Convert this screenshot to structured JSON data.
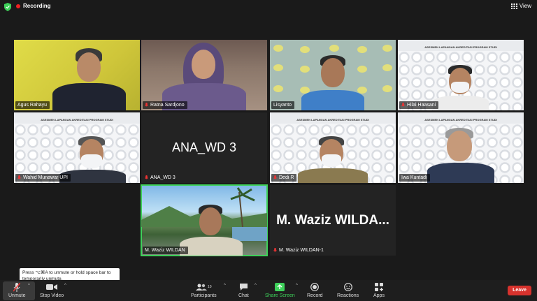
{
  "topbar": {
    "recording_label": "Recording",
    "view_label": "View"
  },
  "tiles": [
    {
      "name": "Agus Rahayu"
    },
    {
      "name": "Ratna Sardjono"
    },
    {
      "name": "Lisyanto"
    },
    {
      "name": "Hilal Haasani"
    },
    {
      "name": "Wahid Munawar UPI"
    },
    {
      "name": "ANA_WD 3",
      "big": "ANA_WD 3"
    },
    {
      "name": "Dedi R"
    },
    {
      "name": "Iwa Kuntadi"
    },
    {
      "name": "M. Waziz WILDAN"
    },
    {
      "name": "M. Waziz WILDAN-1",
      "big": "M. Waziz WILDA..."
    }
  ],
  "banner_text": "ASESMEN LAPANGAN AKREDITASI PROGRAM STUDI",
  "tooltip": "Press ⌥⌘A to unmute or hold space bar to temporarily unmute.",
  "toolbar": {
    "unmute": "Unmute",
    "stop_video": "Stop Video",
    "participants": "Participants",
    "participants_count": "10",
    "chat": "Chat",
    "share_screen": "Share Screen",
    "record": "Record",
    "reactions": "Reactions",
    "apps": "Apps",
    "leave": "Leave"
  },
  "colors": {
    "accent_green": "#3ed15a",
    "leave_red": "#d7322d",
    "recording_red": "#e22222"
  }
}
